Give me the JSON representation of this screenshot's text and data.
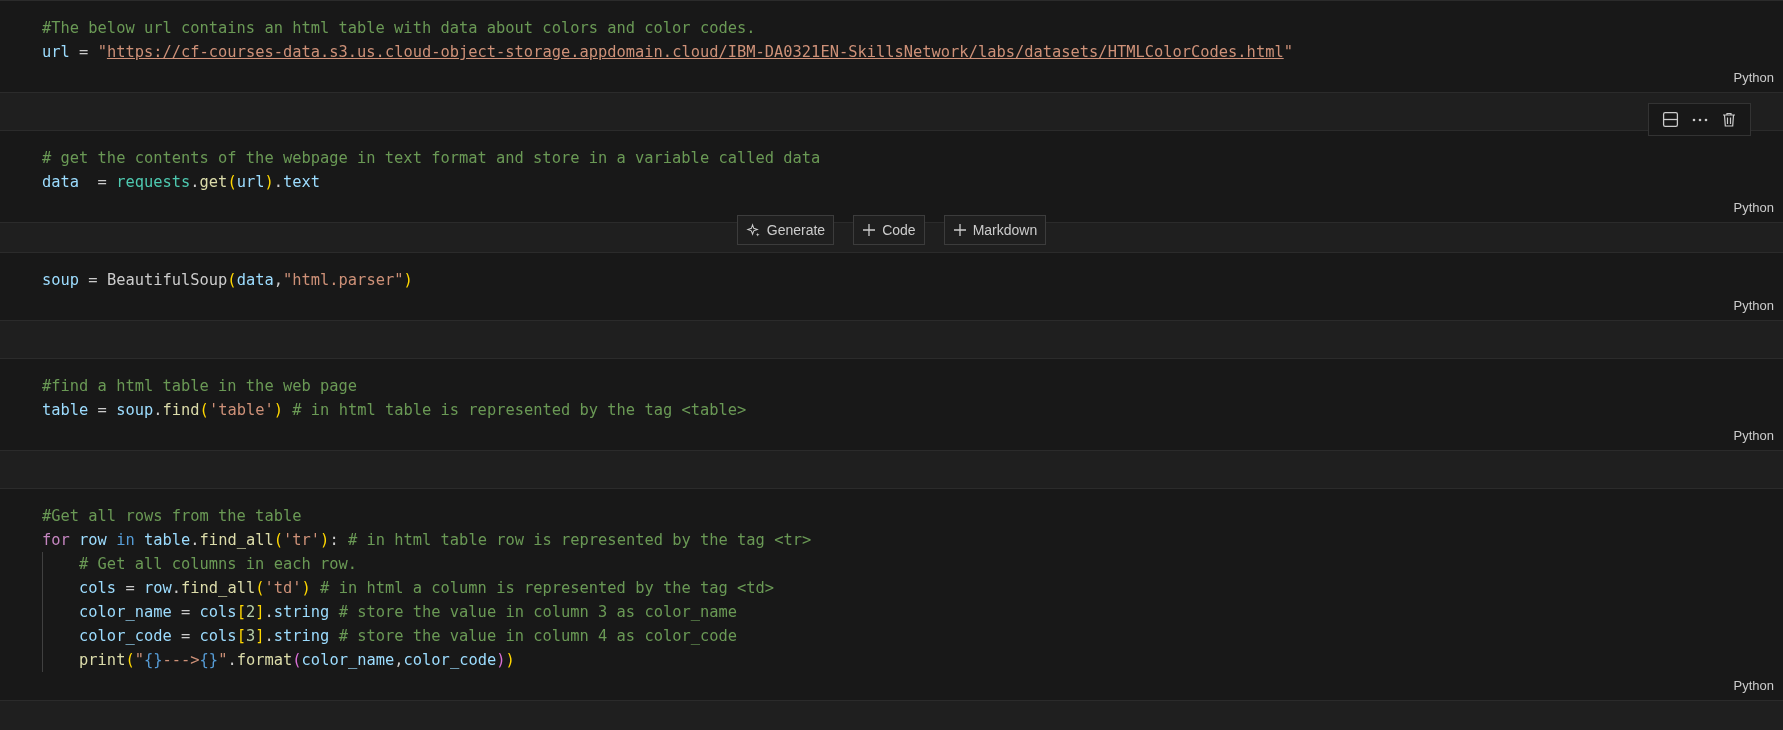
{
  "cells": [
    {
      "kind": "code",
      "language": "Python",
      "toolbar_visible": false,
      "lines": [
        {
          "tokens": [
            {
              "kind": "comment",
              "text": "#The below url contains an html table with data about colors and color codes."
            }
          ]
        },
        {
          "tokens": [
            {
              "kind": "variable",
              "text": "url"
            },
            {
              "kind": "plain",
              "text": " = "
            },
            {
              "kind": "string",
              "text": "\""
            },
            {
              "kind": "link",
              "text": "https://cf-courses-data.s3.us.cloud-object-storage.appdomain.cloud/IBM-DA0321EN-SkillsNetwork/labs/datasets/HTMLColorCodes.html"
            },
            {
              "kind": "string",
              "text": "\""
            }
          ]
        }
      ]
    },
    {
      "kind": "code",
      "language": "Python",
      "toolbar_visible": true,
      "insert_buttons": [
        {
          "kind": "sparkle",
          "label": "Generate"
        },
        {
          "kind": "plus",
          "label": "Code"
        },
        {
          "kind": "plus",
          "label": "Markdown"
        }
      ],
      "lines": [
        {
          "tokens": [
            {
              "kind": "comment",
              "text": "# get the contents of the webpage in text format and store in a variable called data"
            }
          ]
        },
        {
          "tokens": [
            {
              "kind": "variable",
              "text": "data"
            },
            {
              "kind": "plain",
              "text": "  = "
            },
            {
              "kind": "class",
              "text": "requests"
            },
            {
              "kind": "plain",
              "text": "."
            },
            {
              "kind": "function",
              "text": "get"
            },
            {
              "kind": "bracket1",
              "text": "("
            },
            {
              "kind": "variable",
              "text": "url"
            },
            {
              "kind": "bracket1",
              "text": ")"
            },
            {
              "kind": "plain",
              "text": "."
            },
            {
              "kind": "variable",
              "text": "text"
            }
          ]
        }
      ]
    },
    {
      "kind": "code",
      "language": "Python",
      "toolbar_visible": false,
      "lines": [
        {
          "tokens": [
            {
              "kind": "variable",
              "text": "soup"
            },
            {
              "kind": "plain",
              "text": " = BeautifulSoup"
            },
            {
              "kind": "bracket1",
              "text": "("
            },
            {
              "kind": "variable",
              "text": "data"
            },
            {
              "kind": "plain",
              "text": ","
            },
            {
              "kind": "string",
              "text": "\"html.parser\""
            },
            {
              "kind": "bracket1",
              "text": ")"
            }
          ]
        }
      ]
    },
    {
      "kind": "code",
      "language": "Python",
      "toolbar_visible": false,
      "lines": [
        {
          "tokens": [
            {
              "kind": "comment",
              "text": "#find a html table in the web page"
            }
          ]
        },
        {
          "tokens": [
            {
              "kind": "variable",
              "text": "table"
            },
            {
              "kind": "plain",
              "text": " = "
            },
            {
              "kind": "variable",
              "text": "soup"
            },
            {
              "kind": "plain",
              "text": "."
            },
            {
              "kind": "function",
              "text": "find"
            },
            {
              "kind": "bracket1",
              "text": "("
            },
            {
              "kind": "string",
              "text": "'table'"
            },
            {
              "kind": "bracket1",
              "text": ")"
            },
            {
              "kind": "comment",
              "text": " # in html table is represented by the tag <table>"
            }
          ]
        }
      ]
    },
    {
      "kind": "code",
      "language": "Python",
      "toolbar_visible": false,
      "lines": [
        {
          "tokens": [
            {
              "kind": "comment",
              "text": "#Get all rows from the table"
            }
          ]
        },
        {
          "tokens": [
            {
              "kind": "keyword",
              "text": "for"
            },
            {
              "kind": "variable",
              "text": " row"
            },
            {
              "kind": "operator",
              "text": " in"
            },
            {
              "kind": "variable",
              "text": " table"
            },
            {
              "kind": "plain",
              "text": "."
            },
            {
              "kind": "function",
              "text": "find_all"
            },
            {
              "kind": "bracket1",
              "text": "("
            },
            {
              "kind": "string",
              "text": "'tr'"
            },
            {
              "kind": "bracket1",
              "text": ")"
            },
            {
              "kind": "plain",
              "text": ":"
            },
            {
              "kind": "comment",
              "text": " # in html table row is represented by the tag <tr>"
            }
          ],
          "children": [
            {
              "tokens": [
                {
                  "kind": "comment",
                  "text": "# Get all columns in each row."
                }
              ]
            },
            {
              "tokens": [
                {
                  "kind": "variable",
                  "text": "cols"
                },
                {
                  "kind": "plain",
                  "text": " = "
                },
                {
                  "kind": "variable",
                  "text": "row"
                },
                {
                  "kind": "plain",
                  "text": "."
                },
                {
                  "kind": "function",
                  "text": "find_all"
                },
                {
                  "kind": "bracket1",
                  "text": "("
                },
                {
                  "kind": "string",
                  "text": "'td'"
                },
                {
                  "kind": "bracket1",
                  "text": ")"
                },
                {
                  "kind": "comment",
                  "text": " # in html a column is represented by the tag <td>"
                }
              ]
            },
            {
              "tokens": [
                {
                  "kind": "variable",
                  "text": "color_name"
                },
                {
                  "kind": "plain",
                  "text": " = "
                },
                {
                  "kind": "variable",
                  "text": "cols"
                },
                {
                  "kind": "bracket1",
                  "text": "["
                },
                {
                  "kind": "number",
                  "text": "2"
                },
                {
                  "kind": "bracket1",
                  "text": "]"
                },
                {
                  "kind": "plain",
                  "text": "."
                },
                {
                  "kind": "variable",
                  "text": "string"
                },
                {
                  "kind": "comment",
                  "text": " # store the value in column 3 as color_name"
                }
              ]
            },
            {
              "tokens": [
                {
                  "kind": "variable",
                  "text": "color_code"
                },
                {
                  "kind": "plain",
                  "text": " = "
                },
                {
                  "kind": "variable",
                  "text": "cols"
                },
                {
                  "kind": "bracket1",
                  "text": "["
                },
                {
                  "kind": "number",
                  "text": "3"
                },
                {
                  "kind": "bracket1",
                  "text": "]"
                },
                {
                  "kind": "plain",
                  "text": "."
                },
                {
                  "kind": "variable",
                  "text": "string"
                },
                {
                  "kind": "comment",
                  "text": " # store the value in column 4 as color_code"
                }
              ]
            },
            {
              "tokens": [
                {
                  "kind": "function",
                  "text": "print"
                },
                {
                  "kind": "bracket1",
                  "text": "("
                },
                {
                  "kind": "string",
                  "text": "\""
                },
                {
                  "kind": "operator",
                  "text": "{}"
                },
                {
                  "kind": "string",
                  "text": "--->"
                },
                {
                  "kind": "operator",
                  "text": "{}"
                },
                {
                  "kind": "string",
                  "text": "\""
                },
                {
                  "kind": "plain",
                  "text": "."
                },
                {
                  "kind": "function",
                  "text": "format"
                },
                {
                  "kind": "bracket2",
                  "text": "("
                },
                {
                  "kind": "variable",
                  "text": "color_name"
                },
                {
                  "kind": "plain",
                  "text": ","
                },
                {
                  "kind": "variable",
                  "text": "color_code"
                },
                {
                  "kind": "bracket2",
                  "text": ")"
                },
                {
                  "kind": "bracket1",
                  "text": ")"
                }
              ]
            }
          ]
        }
      ]
    }
  ]
}
